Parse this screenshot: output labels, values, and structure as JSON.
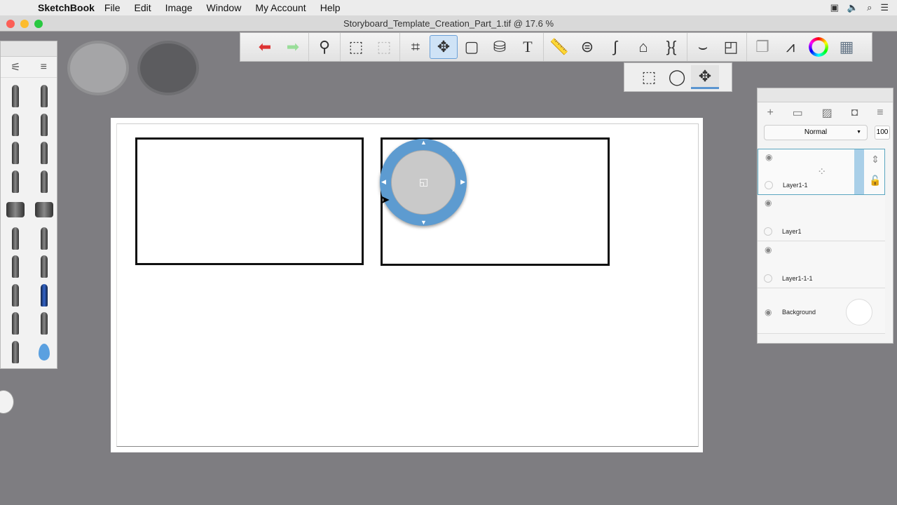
{
  "menubar": {
    "app": "SketchBook",
    "items": [
      "File",
      "Edit",
      "Image",
      "Window",
      "My Account",
      "Help"
    ]
  },
  "window": {
    "title": "Storyboard_Template_Creation_Part_1.tif @ 17.6 %"
  },
  "toolbar": {
    "tools": [
      "undo-icon",
      "redo-icon",
      "zoom-icon",
      "select-icon",
      "crop-select-icon",
      "crop-icon",
      "transform-icon",
      "distort-icon",
      "fill-icon",
      "text-icon",
      "ruler-icon",
      "ellipse-icon",
      "french-curve-icon",
      "perspective-icon",
      "symmetry-icon",
      "stroke-icon",
      "shape-icon",
      "copic-icon",
      "brush-library-icon",
      "color-wheel-icon",
      "swatches-icon"
    ],
    "selected": 6
  },
  "subtoolbar": {
    "tools": [
      "rect-select-icon",
      "lasso-icon",
      "move-icon"
    ],
    "active": 2
  },
  "brushes": {
    "count": 20
  },
  "layers": {
    "blend_mode": "Normal",
    "opacity": "100",
    "items": [
      {
        "name": "Layer1-1",
        "selected": true
      },
      {
        "name": "Layer1"
      },
      {
        "name": "Layer1-1-1"
      },
      {
        "name": "Background"
      }
    ]
  }
}
